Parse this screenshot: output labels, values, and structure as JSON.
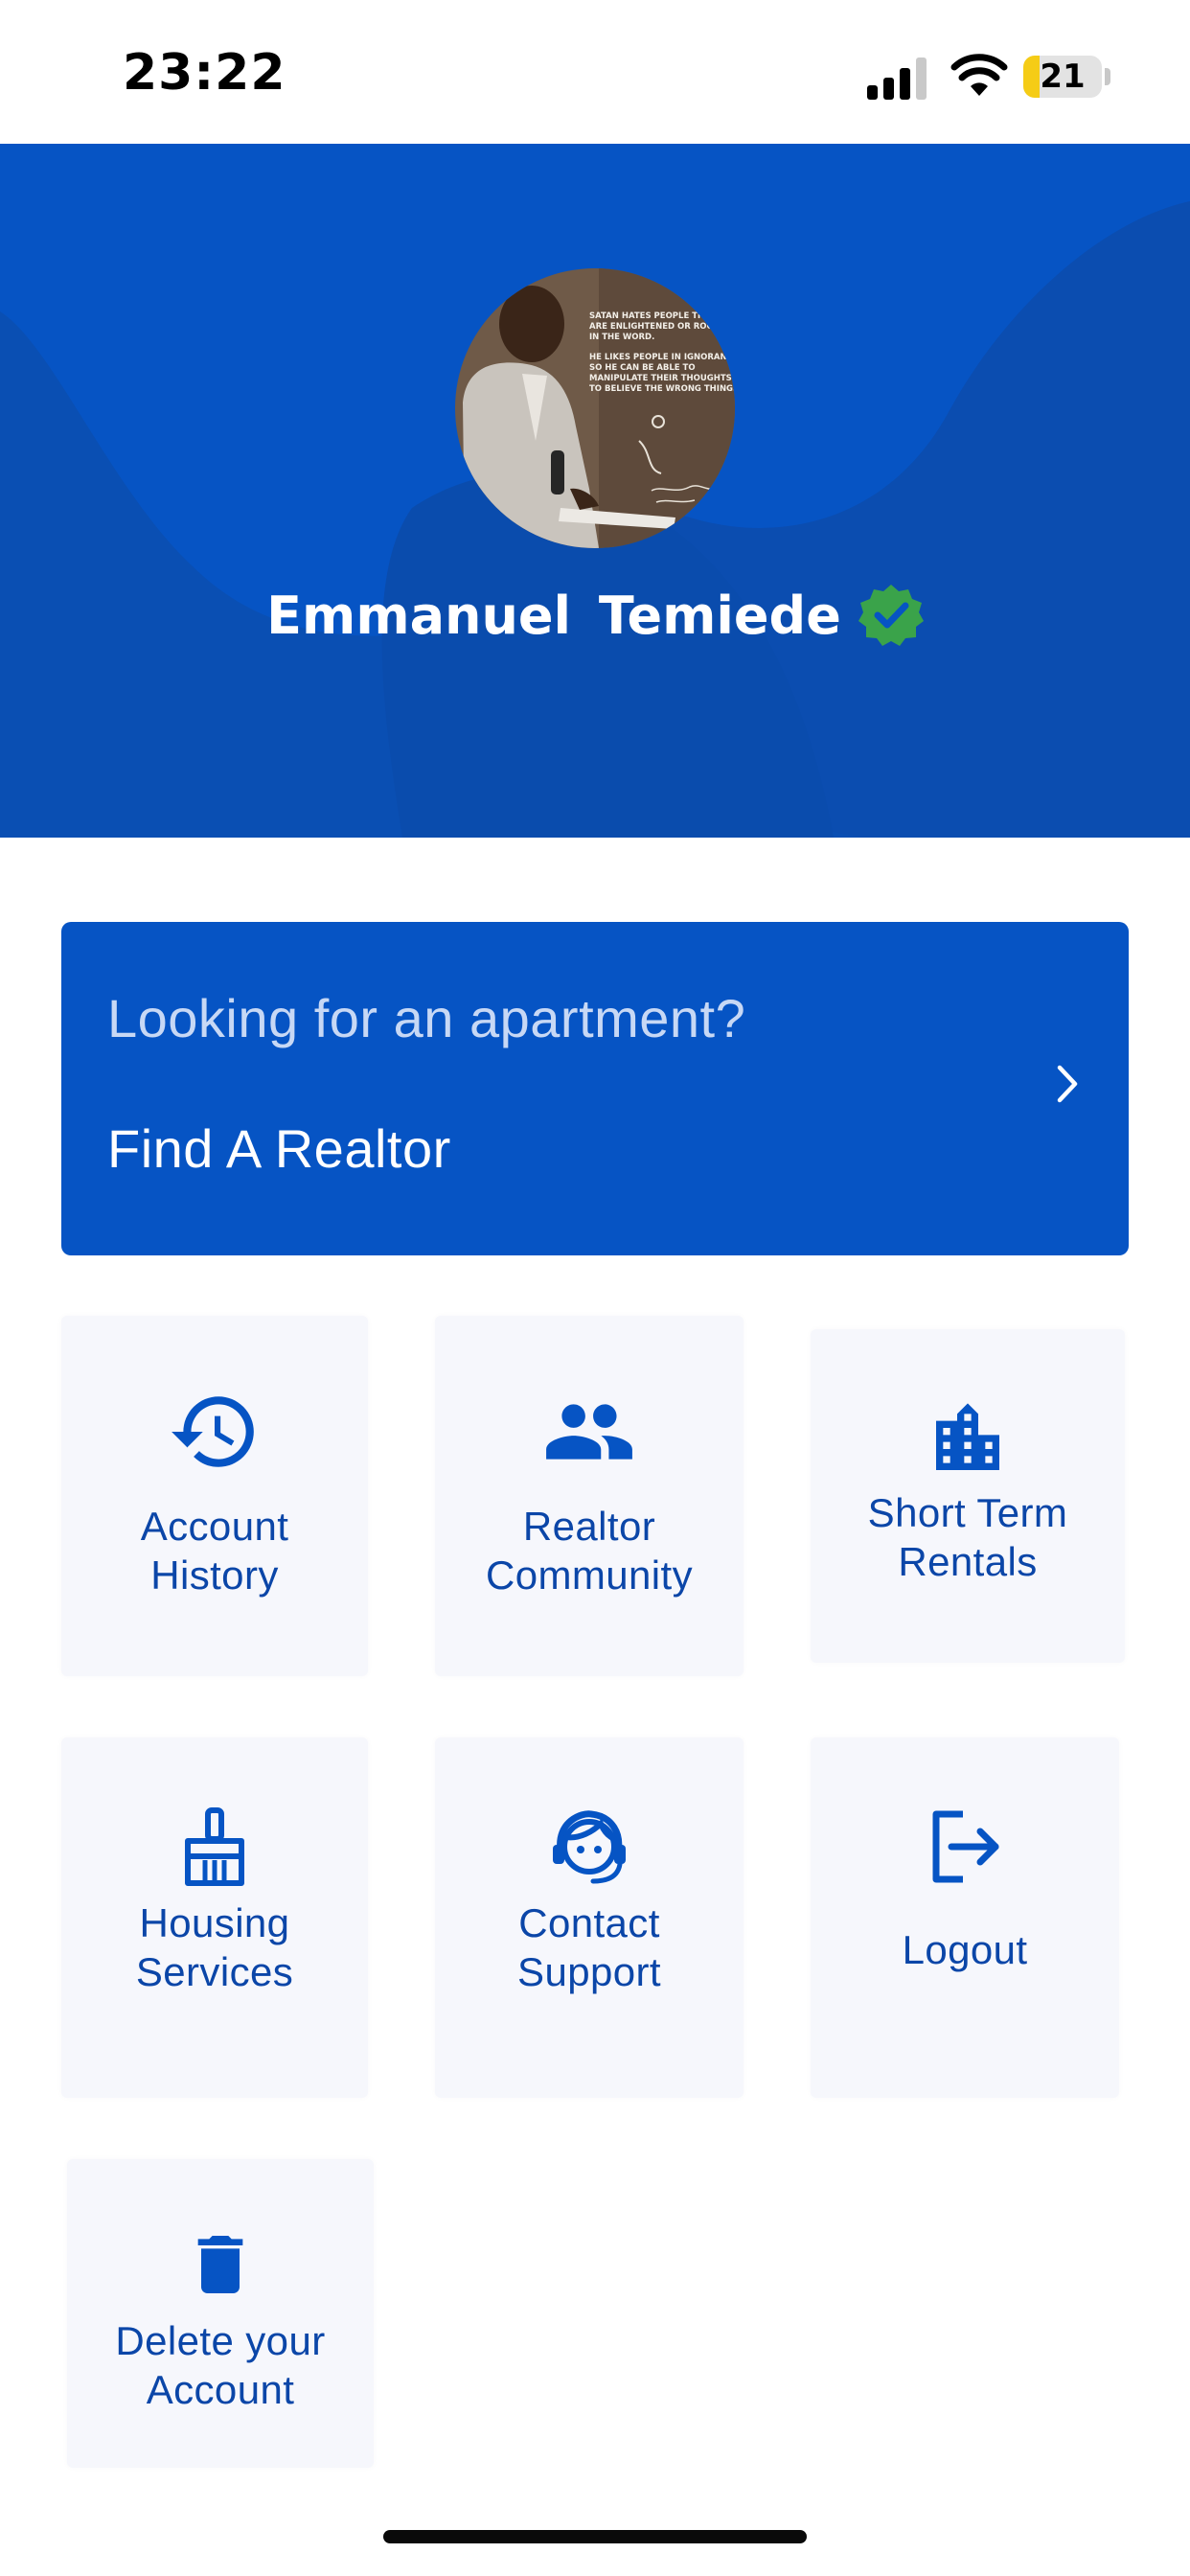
{
  "status_bar": {
    "time": "23:22",
    "battery_level": "21",
    "battery_fraction": 0.21,
    "battery_color": "#f5cc16"
  },
  "profile": {
    "name": "Emmanuel  Temiede",
    "verified": true,
    "verified_color": "#3aa34a",
    "avatar_caption": [
      "SATAN HATES PEOPLE THAT",
      "ARE ENLIGHTENED OR ROOTED",
      "IN THE WORD.",
      "HE LIKES PEOPLE IN IGNORANCE,",
      "SO HE CAN BE ABLE TO",
      "MANIPULATE THEIR THOUGHTS",
      "TO BELIEVE THE WRONG THINGS."
    ]
  },
  "theme": {
    "primary": "#0654c4",
    "tile_background": "#f6f7fc",
    "tile_text": "#0b46a8"
  },
  "banner": {
    "question": "Looking for an apartment?",
    "title": "Find A Realtor",
    "icon": "chevron-right-icon"
  },
  "menu": {
    "account_history": {
      "label": "Account\nHistory",
      "icon": "history-icon"
    },
    "realtor_community": {
      "label": "Realtor\nCommunity",
      "icon": "group-icon"
    },
    "short_term_rentals": {
      "label": "Short Term\nRentals",
      "icon": "building-icon"
    },
    "housing_services": {
      "label": "Housing\nServices",
      "icon": "broom-icon"
    },
    "contact_support": {
      "label": "Contact\nSupport",
      "icon": "support-agent-icon"
    },
    "logout": {
      "label": "Logout",
      "icon": "logout-icon"
    },
    "delete_account": {
      "label": "Delete your\nAccount",
      "icon": "trash-icon"
    }
  }
}
